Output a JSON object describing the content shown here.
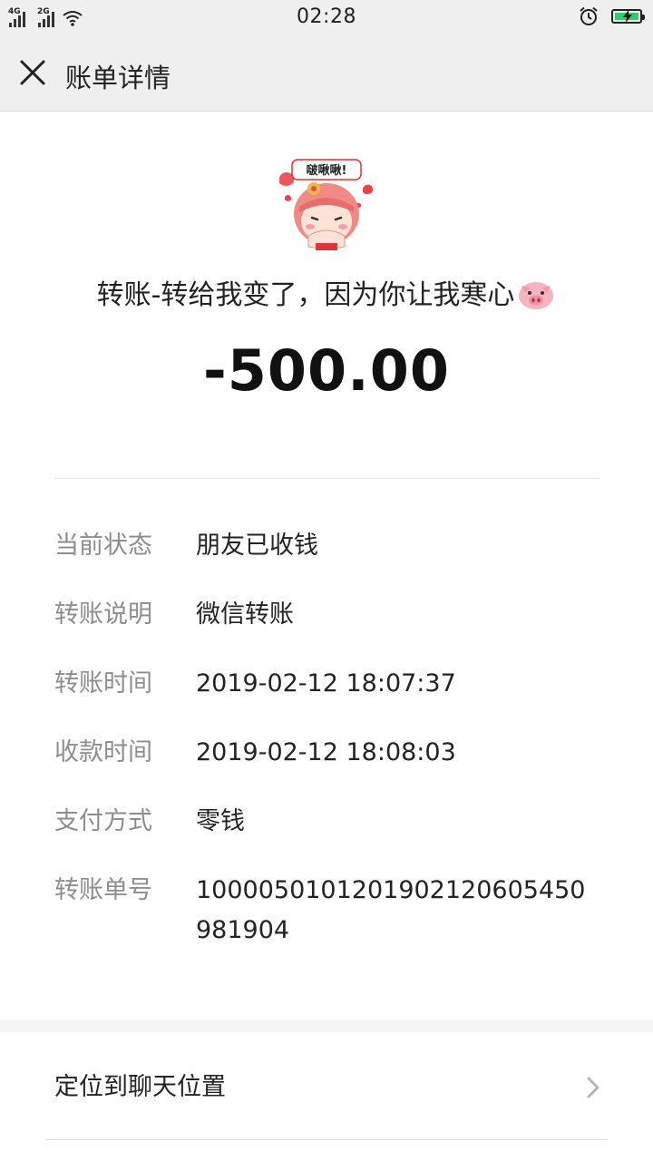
{
  "status_bar": {
    "network1": "4G",
    "network2": "2G",
    "time": "02:28",
    "battery_color": "#2ed06a"
  },
  "nav": {
    "close_icon": "close-x-icon",
    "title": "账单详情"
  },
  "transfer": {
    "remark": "转账-转给我变了，因为你让我寒心",
    "amount": "-500.00",
    "sticker_text": "啵啾啾!"
  },
  "details": [
    {
      "label": "当前状态",
      "value": "朋友已收钱"
    },
    {
      "label": "转账说明",
      "value": "微信转账"
    },
    {
      "label": "转账时间",
      "value": "2019-02-12 18:07:37"
    },
    {
      "label": "收款时间",
      "value": "2019-02-12 18:08:03"
    },
    {
      "label": "支付方式",
      "value": "零钱"
    },
    {
      "label": "转账单号",
      "value": "10000501012019021206054509819​04"
    }
  ],
  "locate_chat": {
    "label": "定位到聊天位置",
    "icon": "chevron-right-icon"
  }
}
